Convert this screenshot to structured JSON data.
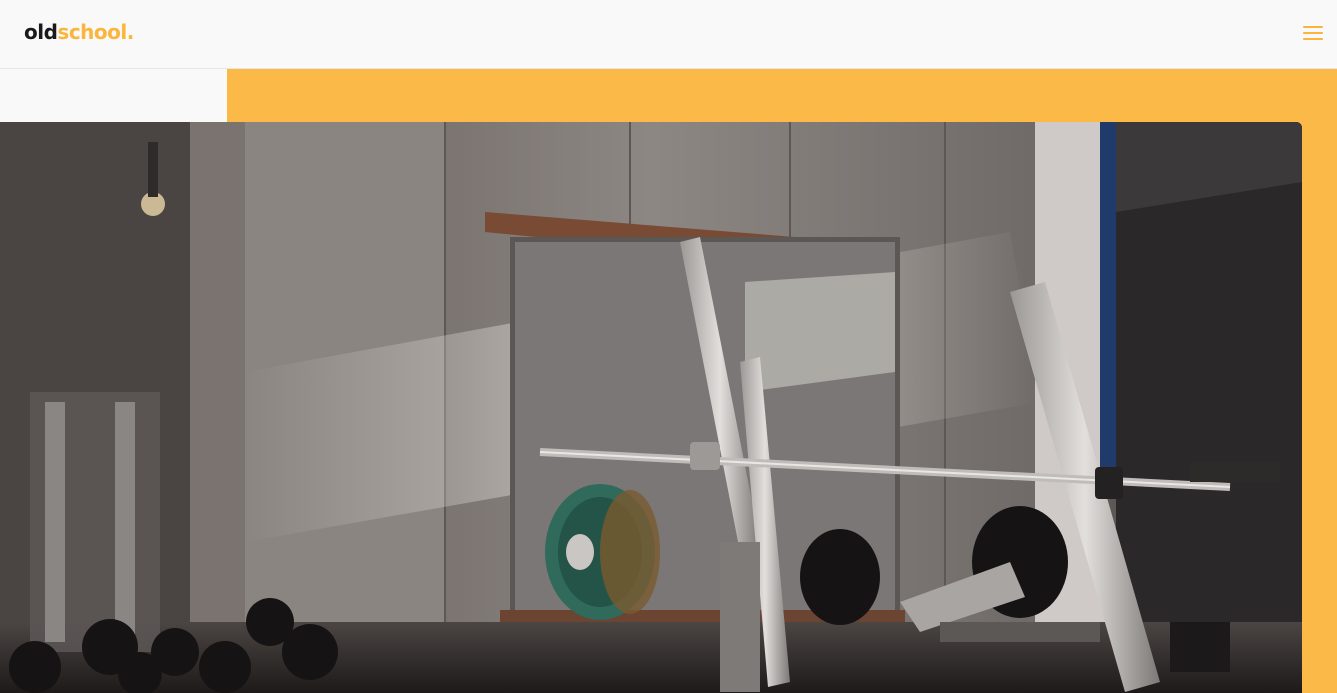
{
  "brand": {
    "part1": "old",
    "part2": "school."
  },
  "icons": {
    "menu": "hamburger-menu-icon"
  },
  "colors": {
    "accent": "#fbb948",
    "logo_dark": "#1a1a1a",
    "logo_accent": "#fbb53c",
    "background": "#f9f9f9"
  },
  "hero": {
    "image_subject": "gym-interior-with-barbell-rack"
  }
}
